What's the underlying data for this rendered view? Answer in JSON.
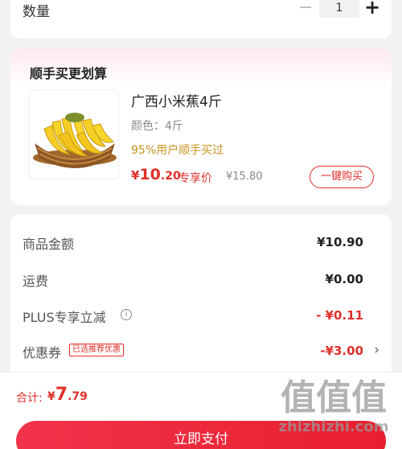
{
  "quantity": {
    "label": "数量",
    "minus": "−",
    "value": "1",
    "plus": "+"
  },
  "bundle": {
    "title": "顺手买更划算",
    "product": {
      "name": "广西小米蕉4斤",
      "spec": "颜色：4斤",
      "social_proof": "95%用户顺手买过",
      "price_currency": "¥",
      "price_int": "10",
      "price_dec": ".20",
      "price_tag": "专享价",
      "original_price": "¥15.80",
      "buy_button": "一键购买",
      "image_icon": "banana-bunch-image"
    }
  },
  "summary": {
    "goods_label": "商品金额",
    "goods_value": "¥10.90",
    "shipping_label": "运费",
    "shipping_value": "¥0.00",
    "plus_label": "PLUS专享立减",
    "plus_info_icon": "i",
    "plus_value": "- ¥0.11",
    "coupon_label": "优惠券",
    "coupon_badge": "已选推荐优惠",
    "coupon_value": "-¥3.00",
    "coupon_chevron": "›"
  },
  "footer": {
    "total_label": "合计:",
    "total_currency": "¥",
    "total_int": "7",
    "total_dec": ".79",
    "pay_button": "立即支付"
  },
  "watermark": {
    "glyphs": "值值值",
    "url": "zhizhizhi.com"
  },
  "colors": {
    "accent": "#e0302b",
    "gold": "#c9921e",
    "pay_gradient_start": "#f2324a",
    "pay_gradient_end": "#e81f2e"
  }
}
